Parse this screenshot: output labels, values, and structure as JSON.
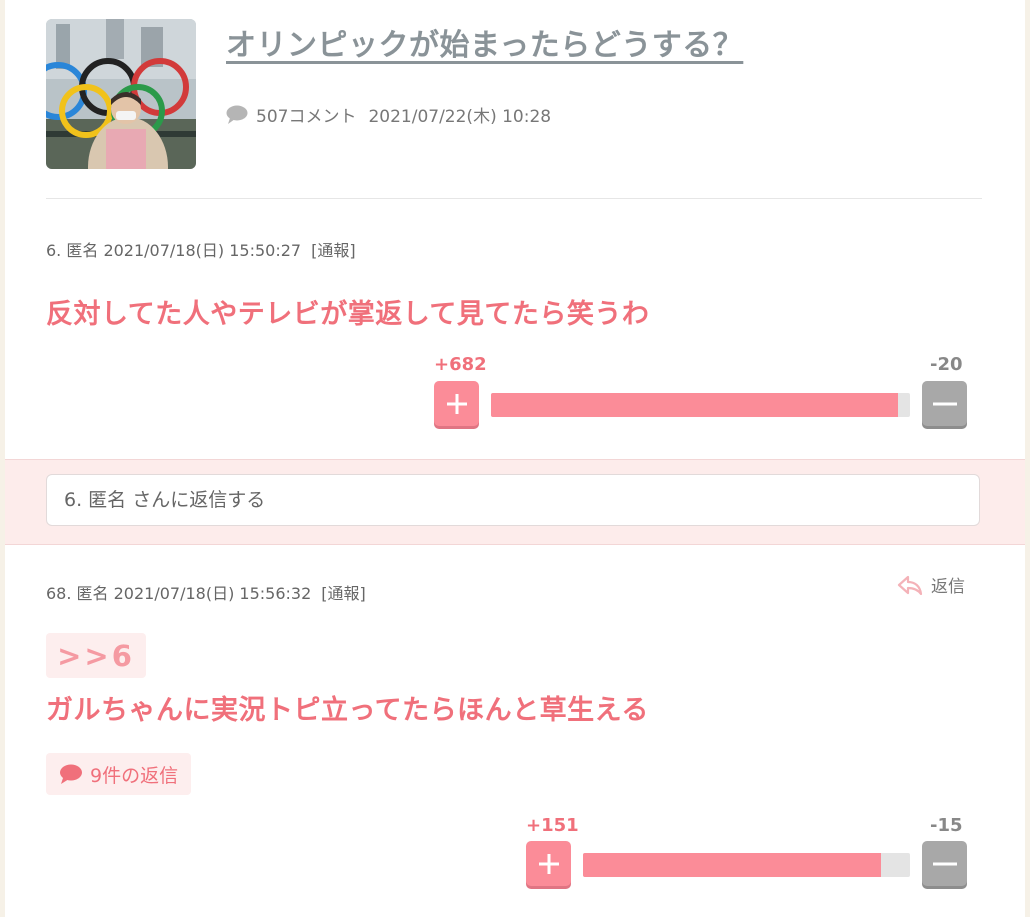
{
  "topic": {
    "title": "オリンピックが始まったらどうする？",
    "comment_count": "507コメント",
    "date": "2021/07/22(木) 10:28"
  },
  "comments": [
    {
      "header": "6. 匿名 2021/07/18(日) 15:50:27",
      "report": "[通報]",
      "body": "反対してた人やテレビが掌返して見てたら笑うわ",
      "plus": "+682",
      "minus": "-20",
      "plus_ratio": 0.971
    },
    {
      "header": "68. 匿名 2021/07/18(日) 15:56:32",
      "report": "[通報]",
      "reply_label": "返信",
      "anchor": ">>6",
      "body": "ガルちゃんに実況トピ立ってたらほんと草生える",
      "replies": "9件の返信",
      "plus": "+151",
      "minus": "-15",
      "plus_ratio": 0.91
    }
  ],
  "reply_box": {
    "placeholder": "6. 匿名 さんに返信する"
  },
  "colors": {
    "accent": "#f0707b",
    "vote_plus": "#fb8c98",
    "vote_minus": "#a8a8a8",
    "reply_band": "#fdeceb"
  }
}
